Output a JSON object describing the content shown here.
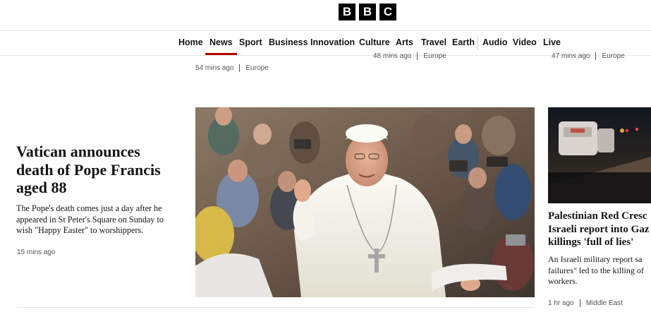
{
  "logo": {
    "letters": [
      "B",
      "B",
      "C"
    ]
  },
  "nav": {
    "items": [
      {
        "label": "Home",
        "active": false
      },
      {
        "label": "News",
        "active": true
      },
      {
        "label": "Sport",
        "active": false
      },
      {
        "label": "Business",
        "active": false
      },
      {
        "label": "Innovation",
        "active": false
      },
      {
        "label": "Culture",
        "active": false
      },
      {
        "label": "Arts",
        "active": false
      },
      {
        "label": "Travel",
        "active": false
      },
      {
        "label": "Earth",
        "active": false
      },
      {
        "label": "Audio",
        "active": false
      },
      {
        "label": "Video",
        "active": false
      },
      {
        "label": "Live",
        "active": false
      }
    ],
    "accent_color": "#b80000"
  },
  "previous_row": [
    {
      "time": "54 mins ago",
      "region": "Europe"
    },
    {
      "time": "48 mins ago",
      "region": "Europe"
    },
    {
      "time": "47 mins ago",
      "region": "Europe"
    }
  ],
  "main_story": {
    "headline_lines": [
      "Vatican announces",
      "death of Pope Francis",
      "aged 88"
    ],
    "summary_lines": [
      "The Pope's death comes just a day after he",
      "appeared in St Peter's Square on Sunday to",
      "wish \"Happy Easter\" to worshippers."
    ],
    "time": "15 mins ago"
  },
  "side_story": {
    "headline_lines": [
      "Palestinian Red Cresc",
      "Israeli report into Gaz",
      "killings 'full of lies'"
    ],
    "summary_lines": [
      "An Israeli military report sa",
      "failures\" led to the killing of",
      "workers."
    ],
    "time": "1 hr ago",
    "region": "Middle East"
  }
}
